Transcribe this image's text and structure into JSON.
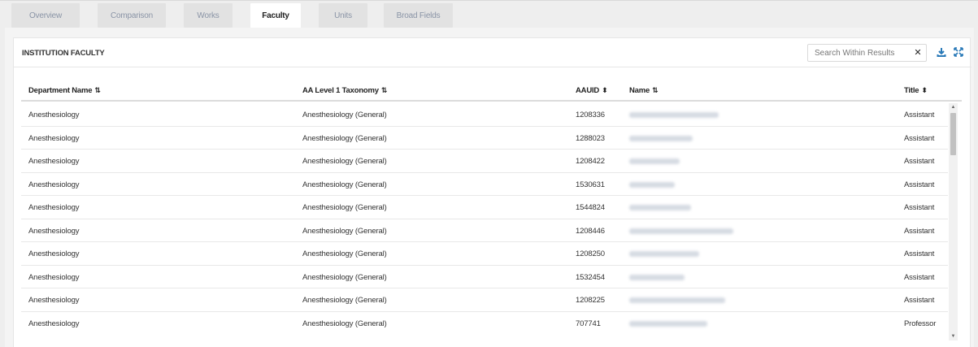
{
  "tabs": [
    {
      "label": "Overview",
      "active": false
    },
    {
      "label": "Comparison",
      "active": false
    },
    {
      "label": "Works",
      "active": false
    },
    {
      "label": "Faculty",
      "active": true
    },
    {
      "label": "Units",
      "active": false
    },
    {
      "label": "Broad Fields",
      "active": false
    }
  ],
  "panel": {
    "title": "INSTITUTION FACULTY",
    "search": {
      "placeholder": "Search Within Results",
      "value": "",
      "clear_label": "✕"
    }
  },
  "table": {
    "columns": [
      {
        "label": "Department Name",
        "sort": "filter"
      },
      {
        "label": "AA Level 1 Taxonomy",
        "sort": "filter"
      },
      {
        "label": "AAUID",
        "sort": "both"
      },
      {
        "label": "Name",
        "sort": "filter"
      },
      {
        "label": "Title",
        "sort": "both"
      }
    ],
    "rows": [
      {
        "department": "Anesthesiology",
        "taxonomy": "Anesthesiology (General)",
        "aauid": "1208336",
        "title": "Assistant"
      },
      {
        "department": "Anesthesiology",
        "taxonomy": "Anesthesiology (General)",
        "aauid": "1288023",
        "title": "Assistant"
      },
      {
        "department": "Anesthesiology",
        "taxonomy": "Anesthesiology (General)",
        "aauid": "1208422",
        "title": "Assistant"
      },
      {
        "department": "Anesthesiology",
        "taxonomy": "Anesthesiology (General)",
        "aauid": "1530631",
        "title": "Assistant"
      },
      {
        "department": "Anesthesiology",
        "taxonomy": "Anesthesiology (General)",
        "aauid": "1544824",
        "title": "Assistant"
      },
      {
        "department": "Anesthesiology",
        "taxonomy": "Anesthesiology (General)",
        "aauid": "1208446",
        "title": "Assistant"
      },
      {
        "department": "Anesthesiology",
        "taxonomy": "Anesthesiology (General)",
        "aauid": "1208250",
        "title": "Assistant"
      },
      {
        "department": "Anesthesiology",
        "taxonomy": "Anesthesiology (General)",
        "aauid": "1532454",
        "title": "Assistant"
      },
      {
        "department": "Anesthesiology",
        "taxonomy": "Anesthesiology (General)",
        "aauid": "1208225",
        "title": "Assistant"
      },
      {
        "department": "Anesthesiology",
        "taxonomy": "Anesthesiology (General)",
        "aauid": "707741",
        "title": "Professor"
      }
    ]
  },
  "icons": {
    "download": "download-icon",
    "expand": "expand-icon",
    "sort_filter": "sort-filter-icon",
    "sort_both": "sort-both-icon"
  },
  "colors": {
    "accent": "#2a7ab8",
    "tab_inactive_bg": "#e2e2e2",
    "tab_inactive_text": "#8a94a6"
  }
}
